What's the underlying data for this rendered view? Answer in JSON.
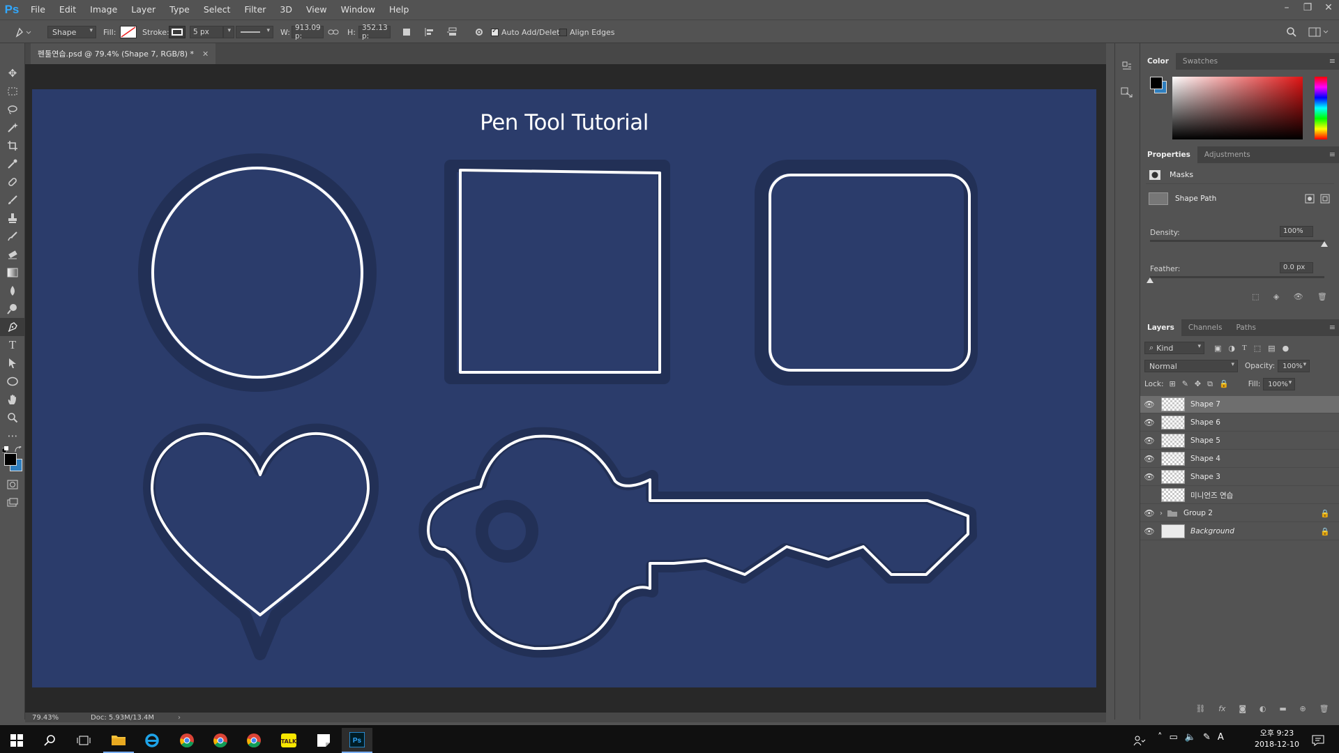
{
  "app": {
    "logo": "Ps",
    "menu": [
      "File",
      "Edit",
      "Image",
      "Layer",
      "Type",
      "Select",
      "Filter",
      "3D",
      "View",
      "Window",
      "Help"
    ],
    "window_controls": [
      "–",
      "❐",
      "✕"
    ]
  },
  "options_bar": {
    "mode": "Shape",
    "fill_label": "Fill:",
    "stroke_label": "Stroke:",
    "stroke_width": "5 px",
    "w_label": "W:",
    "w_value": "913.09 p:",
    "h_label": "H:",
    "h_value": "352.13 p:",
    "auto_add_delete": "Auto Add/Delete",
    "align_edges": "Align Edges",
    "auto_add_checked": true,
    "align_edges_checked": false
  },
  "document": {
    "tab_title": "펜툴연습.psd @ 79.4% (Shape 7, RGB/8) *",
    "canvas_title": "Pen Tool Tutorial",
    "zoom": "79.43%",
    "doc_size": "Doc: 5.93M/13.4M",
    "colors": {
      "canvas_bg": "#2b3c6b",
      "shape_stroke": "#ffffff",
      "shape_glow": "#223056"
    }
  },
  "color_panel": {
    "tabs": [
      "Color",
      "Swatches"
    ],
    "foreground": "#000000",
    "background": "#2f7fbf"
  },
  "properties_panel": {
    "tabs": [
      "Properties",
      "Adjustments"
    ],
    "section": "Masks",
    "shape_path": "Shape Path",
    "density_label": "Density:",
    "density_value": "100%",
    "feather_label": "Feather:",
    "feather_value": "0.0 px",
    "density_level": 1.0,
    "feather_level": 0.0
  },
  "layers_panel": {
    "tabs": [
      "Layers",
      "Channels",
      "Paths"
    ],
    "filter_kind": "Kind",
    "blend_mode": "Normal",
    "opacity_label": "Opacity:",
    "opacity_value": "100%",
    "lock_label": "Lock:",
    "fill_label": "Fill:",
    "fill_value": "100%",
    "layers": [
      {
        "name": "Shape 7",
        "visible": true,
        "selected": true
      },
      {
        "name": "Shape 6",
        "visible": true
      },
      {
        "name": "Shape 5",
        "visible": true
      },
      {
        "name": "Shape 4",
        "visible": true
      },
      {
        "name": "Shape 3",
        "visible": true
      },
      {
        "name": "미니언즈 연습",
        "visible": false
      },
      {
        "name": "Group 2",
        "visible": true,
        "group": true,
        "locked": true
      },
      {
        "name": "Background",
        "visible": true,
        "locked": true,
        "italic": true
      }
    ]
  },
  "taskbar": {
    "time": "오후 9:23",
    "date": "2018-12-10",
    "ime": "A"
  }
}
